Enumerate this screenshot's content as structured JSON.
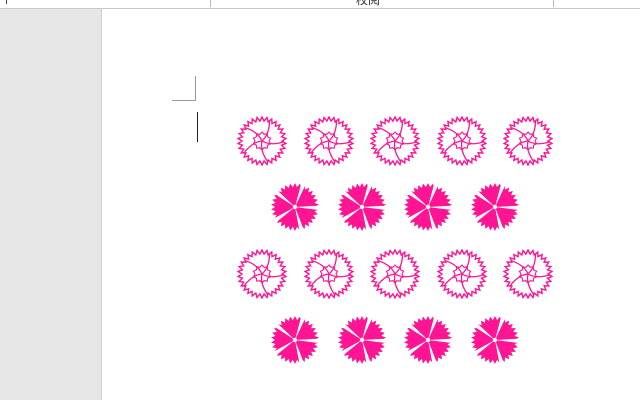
{
  "ribbon": {
    "tab_label": "校阅"
  },
  "document": {
    "flower_color": "#ff1493",
    "rows": [
      {
        "style": "outline",
        "count": 5
      },
      {
        "style": "filled",
        "count": 4
      },
      {
        "style": "outline",
        "count": 5
      },
      {
        "style": "filled",
        "count": 4
      }
    ]
  },
  "icons": {
    "outline_flower": "carnation-outline-icon",
    "filled_flower": "carnation-filled-icon"
  }
}
